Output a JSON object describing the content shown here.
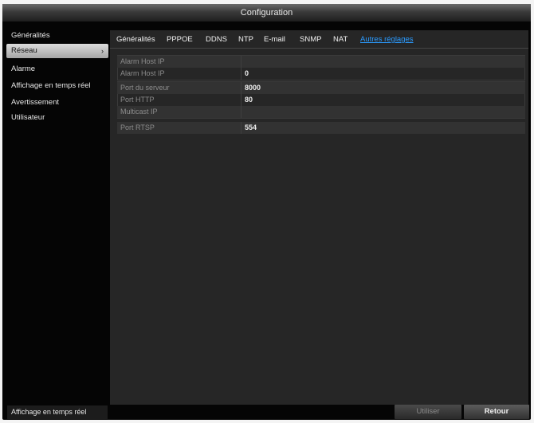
{
  "window": {
    "title": "Configuration"
  },
  "sidebar": {
    "items": [
      {
        "label": "Généralités"
      },
      {
        "label": "Réseau",
        "chevron": "›"
      },
      {
        "label": "Alarme"
      },
      {
        "label": "Affichage en temps réel"
      },
      {
        "label": "Avertissement"
      },
      {
        "label": "Utilisateur"
      }
    ],
    "active": "Réseau"
  },
  "tabs": {
    "items": [
      {
        "label": "Généralités"
      },
      {
        "label": "PPPOE"
      },
      {
        "label": "DDNS"
      },
      {
        "label": "NTP"
      },
      {
        "label": "E-mail"
      },
      {
        "label": "SNMP"
      },
      {
        "label": "NAT"
      },
      {
        "label": "Autres réglages"
      }
    ],
    "active": "Autres réglages"
  },
  "settings": {
    "rows": [
      {
        "label": "Alarm Host IP",
        "value": ""
      },
      {
        "label": "Alarm Host IP",
        "value": "0"
      },
      {
        "label": "Port du serveur",
        "value": "8000"
      },
      {
        "label": "Port HTTP",
        "value": "80"
      },
      {
        "label": "Multicast IP",
        "value": ""
      },
      {
        "label": "Port RTSP",
        "value": "554"
      }
    ]
  },
  "footer": {
    "live_view_label": "Affichage en temps réel",
    "apply_label": "Utiliser",
    "back_label": "Retour"
  },
  "colors": {
    "accent": "#2b9bff",
    "background": "#262626"
  }
}
